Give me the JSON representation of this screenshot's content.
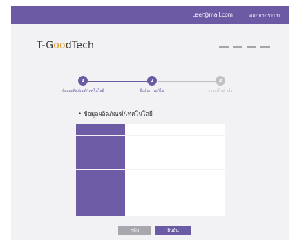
{
  "header": {
    "user": "user@mail.com",
    "logout": "ออกจากระบบ",
    "brand_color": "#6c5aa5"
  },
  "logo": {
    "pre": "T-G",
    "oo": "oo",
    "post": "dTech"
  },
  "menu": {
    "icon": "hamburger-dash-icon"
  },
  "steps": [
    {
      "number": "1",
      "label": "ข้อมูลผลิตภัณฑ์/เทคโนโลยี",
      "state": "done"
    },
    {
      "number": "2",
      "label": "ยืนยันการแก้ไข",
      "state": "current"
    },
    {
      "number": "3",
      "label": "การแก้ไขสำเร็จ",
      "state": "pending"
    }
  ],
  "section": {
    "title": "• ข้อมูลผลิตภัณฑ์/เทคโนโลยี"
  },
  "buttons": {
    "back": "กลับ",
    "confirm": "ยืนยัน"
  }
}
